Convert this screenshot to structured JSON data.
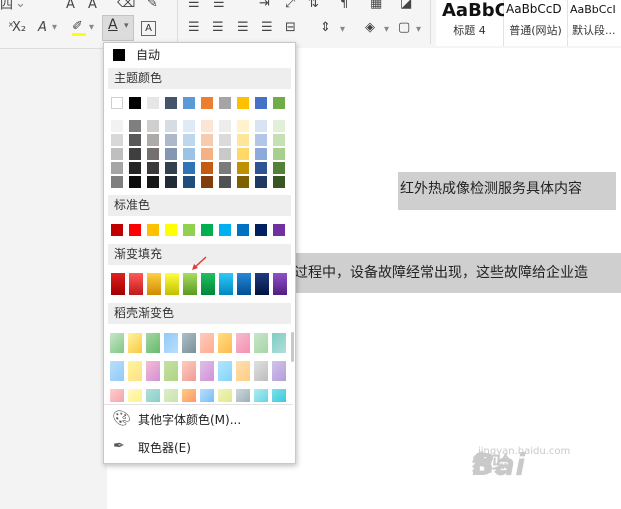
{
  "ribbon": {
    "partial_glyph": "四",
    "font_buttons": [
      "A",
      "A"
    ],
    "subscript_label": "X₂",
    "strike_label": "A",
    "font_color_glyph": "A",
    "box_glyph": "A",
    "styles": [
      {
        "sample": "AaBbC",
        "name": "标题 4"
      },
      {
        "sample": "AaBbCcD",
        "name": "普通(网站)"
      },
      {
        "sample": "AaBbCcI",
        "name": "默认段..."
      }
    ]
  },
  "document": {
    "line1": "红外热成像检测服务具体内容",
    "line2": "过程中，设备故障经常出现，这些故障给企业造"
  },
  "menu": {
    "auto_label": "自动",
    "theme_title": "主题颜色",
    "standard_title": "标准色",
    "gradient_title": "渐变填充",
    "shell_title": "稻壳渐变色",
    "more_colors_label": "其他字体颜色(M)...",
    "picker_label": "取色器(E)",
    "theme_top": [
      "#ffffff",
      "#000000",
      "#e7e6e6",
      "#44546a",
      "#5b9bd5",
      "#ed7d31",
      "#a5a5a5",
      "#ffc000",
      "#4472c4",
      "#70ad47"
    ],
    "theme_shades": [
      [
        "#f2f2f2",
        "#7f7f7f",
        "#d0cece",
        "#d6dce4",
        "#deebf6",
        "#fbe5d5",
        "#ededed",
        "#fff2cc",
        "#dae3f3",
        "#e2efd9"
      ],
      [
        "#d8d8d8",
        "#595959",
        "#aeaaaa",
        "#adb9ca",
        "#bdd7ee",
        "#f7cbac",
        "#dbdbdb",
        "#fee599",
        "#b4c6e7",
        "#c5e0b3"
      ],
      [
        "#bfbfbf",
        "#3f3f3f",
        "#757070",
        "#8496b0",
        "#9cc3e5",
        "#f4b183",
        "#c9c9c9",
        "#ffd965",
        "#8eaadb",
        "#a8d08d"
      ],
      [
        "#a5a5a5",
        "#262626",
        "#3a3838",
        "#323f4f",
        "#2e75b5",
        "#c55a11",
        "#7b7b7b",
        "#bf9000",
        "#2f5496",
        "#538135"
      ],
      [
        "#7f7f7f",
        "#0c0c0c",
        "#171616",
        "#222a35",
        "#1e4e79",
        "#833c0b",
        "#525252",
        "#7f6000",
        "#1f3864",
        "#375623"
      ]
    ],
    "standard_colors": [
      "#c00000",
      "#ff0000",
      "#ffc000",
      "#ffff00",
      "#92d050",
      "#00b050",
      "#00b0f0",
      "#0070c0",
      "#002060",
      "#7030a0"
    ],
    "gradient_colors": [
      [
        "#e02020",
        "#a00000"
      ],
      [
        "#ff5a5a",
        "#c01818"
      ],
      [
        "#ffd040",
        "#d08a00"
      ],
      [
        "#ffff40",
        "#c0c000"
      ],
      [
        "#a8dc60",
        "#5a9a20"
      ],
      [
        "#20c060",
        "#00863a"
      ],
      [
        "#30c8f8",
        "#0088c0"
      ],
      [
        "#2888d8",
        "#004f92"
      ],
      [
        "#203a80",
        "#001440"
      ],
      [
        "#9050c8",
        "#501e80"
      ]
    ],
    "shell_rows": [
      [
        [
          "#c8e6c9",
          "#81c784"
        ],
        [
          "#fff3a0",
          "#f8c840"
        ],
        [
          "#a5d6a7",
          "#66bb6a"
        ],
        [
          "#90caf9",
          "#bbdefb"
        ],
        [
          "#b0bec5",
          "#78909c"
        ],
        [
          "#ffccbc",
          "#ffab91"
        ],
        [
          "#ffe082",
          "#ffb74d"
        ],
        [
          "#f8bbd0",
          "#f48fb1"
        ],
        [
          "#c8e6c9",
          "#a5d6a7"
        ],
        [
          "#80cbc4",
          "#b2dfdb"
        ]
      ],
      [
        [
          "#bbdefb",
          "#90caf9"
        ],
        [
          "#fff59d",
          "#ffe082"
        ],
        [
          "#f8bbd0",
          "#ce93d8"
        ],
        [
          "#c5e1a5",
          "#aed581"
        ],
        [
          "#ffccbc",
          "#ef9a9a"
        ],
        [
          "#e1bee7",
          "#ce93d8"
        ],
        [
          "#b3e5fc",
          "#81d4fa"
        ],
        [
          "#ffe0b2",
          "#ffcc80"
        ],
        [
          "#e0e0e0",
          "#bdbdbd"
        ],
        [
          "#d1c4e9",
          "#b39ddb"
        ]
      ],
      [
        [
          "#ffcdd2",
          "#ef9a9a"
        ],
        [
          "#fff9c4",
          "#fff176"
        ],
        [
          "#b2dfdb",
          "#80cbc4"
        ],
        [
          "#dcedc8",
          "#c5e1a5"
        ],
        [
          "#ffcc80",
          "#ff8a65"
        ],
        [
          "#bbdefb",
          "#64b5f6"
        ],
        [
          "#f0f4c3",
          "#dce775"
        ],
        [
          "#cfd8dc",
          "#90a4ae"
        ],
        [
          "#b2ebf2",
          "#4dd0e1"
        ],
        [
          "#80deea",
          "#26c6da"
        ]
      ]
    ]
  },
  "watermark": {
    "brand": "Bai",
    "brand2": "经验",
    "url": "jingyan.baidu.com"
  },
  "colors": {
    "accent_arrow": "#e53935",
    "selected_auto": "#000000"
  }
}
